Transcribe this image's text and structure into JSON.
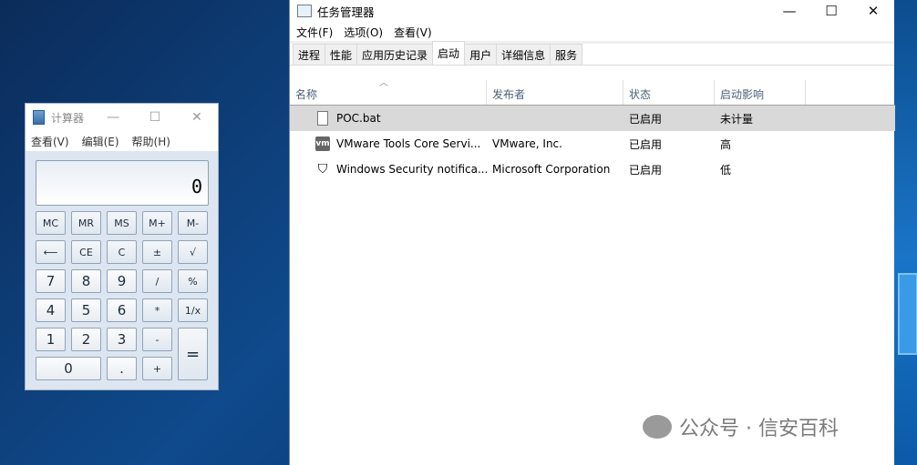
{
  "calculator": {
    "title": "计算器",
    "menu": [
      "查看(V)",
      "编辑(E)",
      "帮助(H)"
    ],
    "display": "0",
    "buttons": [
      "MC",
      "MR",
      "MS",
      "M+",
      "M-",
      "⟵",
      "CE",
      "C",
      "±",
      "√",
      "7",
      "8",
      "9",
      "/",
      "%",
      "4",
      "5",
      "6",
      "*",
      "1/x",
      "1",
      "2",
      "3",
      "-",
      "=",
      "0",
      ".",
      "+"
    ]
  },
  "taskmanager": {
    "title": "任务管理器",
    "menu": [
      "文件(F)",
      "选项(O)",
      "查看(V)"
    ],
    "tabs": [
      "进程",
      "性能",
      "应用历史记录",
      "启动",
      "用户",
      "详细信息",
      "服务"
    ],
    "active_tab": "启动",
    "columns": [
      "名称",
      "发布者",
      "状态",
      "启动影响"
    ],
    "rows": [
      {
        "name": "POC.bat",
        "publisher": "",
        "status": "已启用",
        "impact": "未计量",
        "icon": "file-icon"
      },
      {
        "name": "VMware Tools Core Servi...",
        "publisher": "VMware, Inc.",
        "status": "已启用",
        "impact": "高",
        "icon": "vmware-icon"
      },
      {
        "name": "Windows Security notifica...",
        "publisher": "Microsoft Corporation",
        "status": "已启用",
        "impact": "低",
        "icon": "shield-icon"
      }
    ]
  },
  "watermark": "公众号 · 信安百科"
}
